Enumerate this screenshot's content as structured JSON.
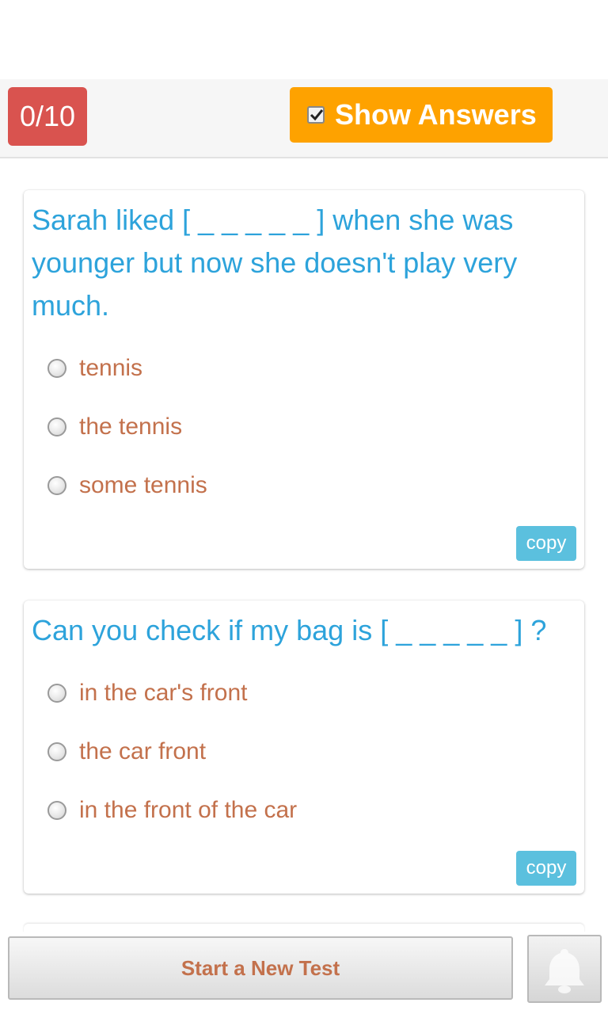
{
  "header": {
    "score": "0/10",
    "show_answers_label": "Show Answers",
    "show_answers_checked": true
  },
  "questions": [
    {
      "text": "Sarah liked [ _ _ _ _ _ ] when she was younger but now she doesn't play very much.",
      "options": [
        "tennis",
        "the tennis",
        "some tennis"
      ],
      "copy_label": "copy"
    },
    {
      "text": "Can you check if my bag is [ _ _ _ _ _ ] ?",
      "options": [
        "in the car's front",
        "the car front",
        "in the front of the car"
      ],
      "copy_label": "copy"
    }
  ],
  "footer": {
    "new_test_label": "Start a New Test",
    "bell_icon": "bell-icon"
  },
  "colors": {
    "score_badge": "#d9534f",
    "show_answers": "#fea200",
    "question_text": "#2da3db",
    "option_text": "#c3714c",
    "copy_button": "#5bc0de"
  }
}
